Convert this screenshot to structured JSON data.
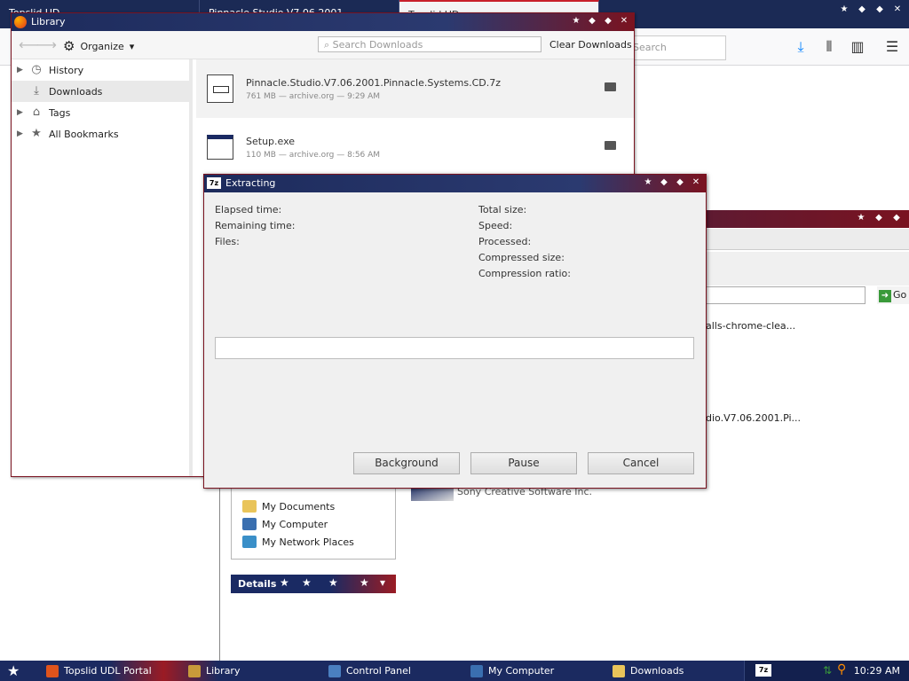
{
  "firefox": {
    "tabs": [
      {
        "label": "Topslid UD"
      },
      {
        "label": "Pinnacle.Studio.V7.06.2001..."
      },
      {
        "label": "Topslid UD"
      }
    ],
    "search_placeholder": "Search",
    "win_buttons": [
      "star",
      "min",
      "max",
      "close"
    ]
  },
  "control_panel": {
    "text_line1": "alls-chrome-clea...",
    "text_line2": "dio.V7.06.2001.Pi...",
    "publisher": "Sony Creative Software Inc.",
    "go_label": "Go",
    "places": [
      {
        "label": "My Documents",
        "icon": "folder-icon",
        "color": "#e9c45a"
      },
      {
        "label": "My Computer",
        "icon": "computer-icon",
        "color": "#3a6fb0"
      },
      {
        "label": "My Network Places",
        "icon": "network-icon",
        "color": "#3a8fc8"
      }
    ],
    "details_label": "Details"
  },
  "library": {
    "title": "Library",
    "organize_label": "Organize",
    "search_placeholder": "Search Downloads",
    "clear_label": "Clear Downloads",
    "sidebar": [
      {
        "label": "History",
        "icon": "clock-icon",
        "glyph": "◷",
        "expandable": true
      },
      {
        "label": "Downloads",
        "icon": "download-icon",
        "glyph": "⤓",
        "expandable": false,
        "selected": true
      },
      {
        "label": "Tags",
        "icon": "tag-icon",
        "glyph": "⌂",
        "expandable": true
      },
      {
        "label": "All Bookmarks",
        "icon": "star-icon",
        "glyph": "★",
        "expandable": true
      }
    ],
    "downloads": [
      {
        "name": "Pinnacle.Studio.V7.06.2001.Pinnacle.Systems.CD.7z",
        "meta": "761 MB — archive.org — 9:29 AM",
        "type": "zip"
      },
      {
        "name": "Setup.exe",
        "meta": "110 MB — archive.org — 8:56 AM",
        "type": "exe"
      }
    ]
  },
  "extract": {
    "title": "Extracting",
    "labels_left": [
      "Elapsed time:",
      "Remaining time:",
      "Files:"
    ],
    "labels_right": [
      "Total size:",
      "Speed:",
      "Processed:",
      "Compressed size:",
      "Compression ratio:"
    ],
    "progress": 0.0,
    "buttons": [
      "Background",
      "Pause",
      "Cancel"
    ]
  },
  "taskbar": {
    "items": [
      {
        "label": "Topslid UDL Portal",
        "icon": "firefox-icon",
        "color": "#e0541c"
      },
      {
        "label": "Library",
        "icon": "library-icon",
        "color": "#c89a3a"
      },
      {
        "label": "Control Panel",
        "icon": "control-panel-icon",
        "color": "#4a7fc0"
      },
      {
        "label": "My Computer",
        "icon": "computer-icon",
        "color": "#3a6fb0"
      },
      {
        "label": "Downloads",
        "icon": "folder-icon",
        "color": "#e9c45a"
      }
    ],
    "clock": "10:29 AM"
  },
  "colors": {
    "navy": "#1b2a60",
    "red": "#9b1b24",
    "progress": "#3cb043"
  }
}
